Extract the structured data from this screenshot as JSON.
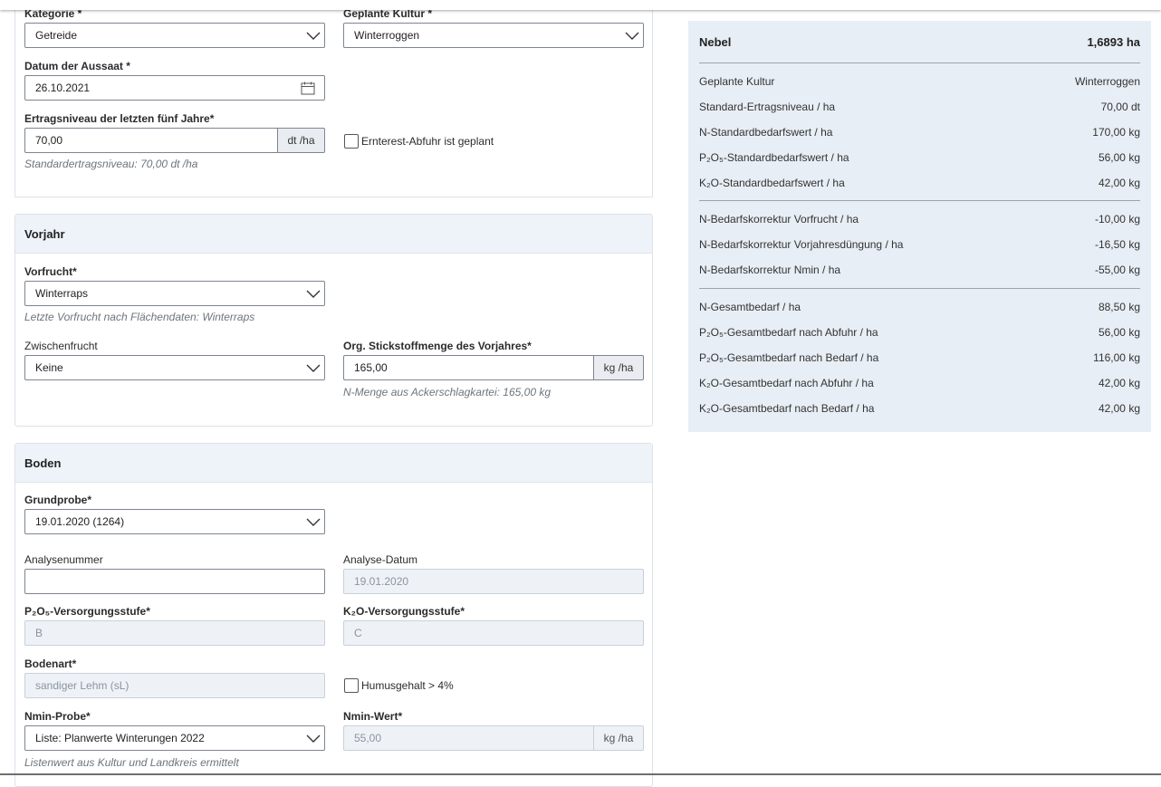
{
  "first_section": {
    "kategorie": {
      "label": "Kategorie *",
      "value": "Getreide"
    },
    "geplante_kultur": {
      "label": "Geplante Kultur *",
      "value": "Winterroggen"
    },
    "datum": {
      "label": "Datum der Aussaat *",
      "value": "26.10.2021"
    },
    "ertrag": {
      "label": "Ertragsniveau der letzten fünf Jahre*",
      "value": "70,00",
      "unit": "dt /ha",
      "hint": "Standardertragsniveau: 70,00 dt /ha"
    },
    "ernterest": {
      "label": "Ernterest-Abfuhr ist geplant",
      "checked": false
    }
  },
  "vorjahr": {
    "title": "Vorjahr",
    "vorfrucht": {
      "label": "Vorfrucht*",
      "value": "Winterraps",
      "hint": "Letzte Vorfrucht nach Flächendaten: Winterraps"
    },
    "zwischenfrucht": {
      "label": "Zwischenfrucht",
      "value": "Keine"
    },
    "org_n": {
      "label": "Org. Stickstoffmenge des Vorjahres*",
      "value": "165,00",
      "unit": "kg /ha",
      "hint": "N-Menge aus Ackerschlagkartei: 165,00 kg"
    }
  },
  "boden": {
    "title": "Boden",
    "grundprobe": {
      "label": "Grundprobe*",
      "value": "19.01.2020 (1264)"
    },
    "analysenummer": {
      "label": "Analysenummer",
      "value": ""
    },
    "analyse_datum": {
      "label": "Analyse-Datum",
      "value": "19.01.2020"
    },
    "p2o5": {
      "label": "P₂O₅-Versorgungsstufe*",
      "value": "B"
    },
    "k2o": {
      "label": "K₂O-Versorgungsstufe*",
      "value": "C"
    },
    "bodenart": {
      "label": "Bodenart*",
      "value": "sandiger Lehm (sL)"
    },
    "humus": {
      "label": "Humusgehalt > 4%",
      "checked": false
    },
    "nmin_probe": {
      "label": "Nmin-Probe*",
      "value": "Liste: Planwerte Winterungen 2022",
      "hint": "Listenwert aus Kultur und Landkreis ermittelt"
    },
    "nmin_wert": {
      "label": "Nmin-Wert*",
      "value": "55,00",
      "unit": "kg /ha"
    }
  },
  "summary": {
    "title": "Nebel",
    "area": "1,6893 ha",
    "rows": [
      {
        "label": "Geplante Kultur",
        "value": "Winterroggen"
      },
      {
        "label": "Standard-Ertragsniveau / ha",
        "value": "70,00 dt"
      },
      {
        "label": "N-Standardbedarfswert / ha",
        "value": "170,00 kg"
      },
      {
        "label": "P₂O₅-Standardbedarfswert / ha",
        "value": "56,00 kg"
      },
      {
        "label": "K₂O-Standardbedarfswert / ha",
        "value": "42,00 kg"
      },
      {
        "label": "N-Bedarfskorrektur Vorfrucht / ha",
        "value": "-10,00 kg"
      },
      {
        "label": "N-Bedarfskorrektur Vorjahresdüngung / ha",
        "value": "-16,50 kg"
      },
      {
        "label": "N-Bedarfskorrektur Nmin / ha",
        "value": "-55,00 kg"
      },
      {
        "label": "N-Gesamtbedarf / ha",
        "value": "88,50 kg"
      },
      {
        "label": "P₂O₅-Gesamtbedarf nach Abfuhr / ha",
        "value": "56,00 kg"
      },
      {
        "label": "P₂O₅-Gesamtbedarf nach Bedarf / ha",
        "value": "116,00 kg"
      },
      {
        "label": "K₂O-Gesamtbedarf nach Abfuhr / ha",
        "value": "42,00 kg"
      },
      {
        "label": "K₂O-Gesamtbedarf nach Bedarf / ha",
        "value": "42,00 kg"
      }
    ]
  },
  "colors": {
    "panel_bg": "#e8eef5",
    "card_head_bg": "#eef3f9",
    "disabled_bg": "#eef2f7"
  }
}
